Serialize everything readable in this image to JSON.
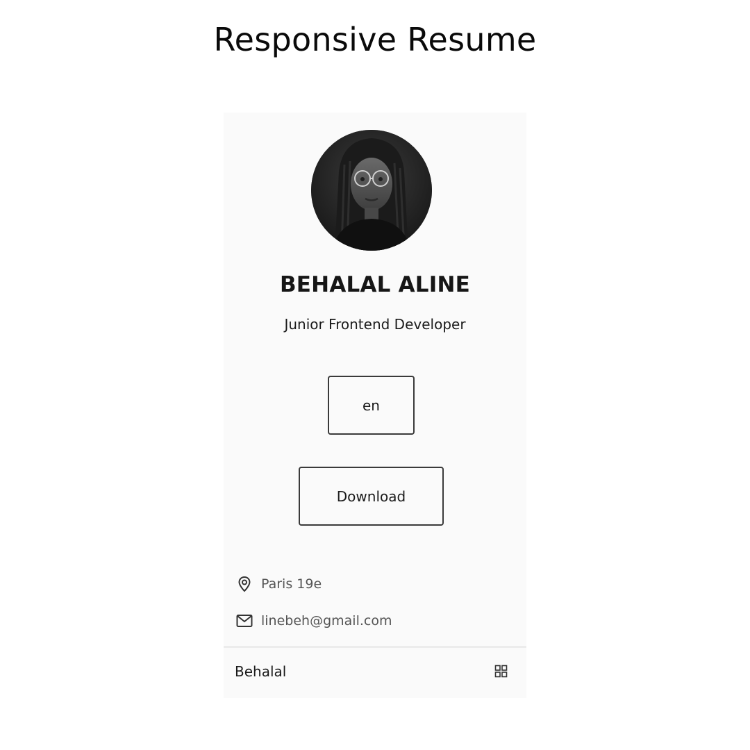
{
  "page": {
    "title": "Responsive Resume"
  },
  "profile": {
    "name": "BEHALAL ALINE",
    "role": "Junior Frontend Developer",
    "avatar_alt": "profile photo"
  },
  "actions": {
    "language_label": "en",
    "download_label": "Download"
  },
  "contact": {
    "location": "Paris 19e",
    "email": "linebeh@gmail.com"
  },
  "footer": {
    "brand": "Behalal",
    "menu_icon": "grid-icon"
  },
  "colors": {
    "card_background": "#fafafa",
    "text_primary": "#161616",
    "text_secondary": "#555555",
    "border": "#3a3a3a"
  }
}
